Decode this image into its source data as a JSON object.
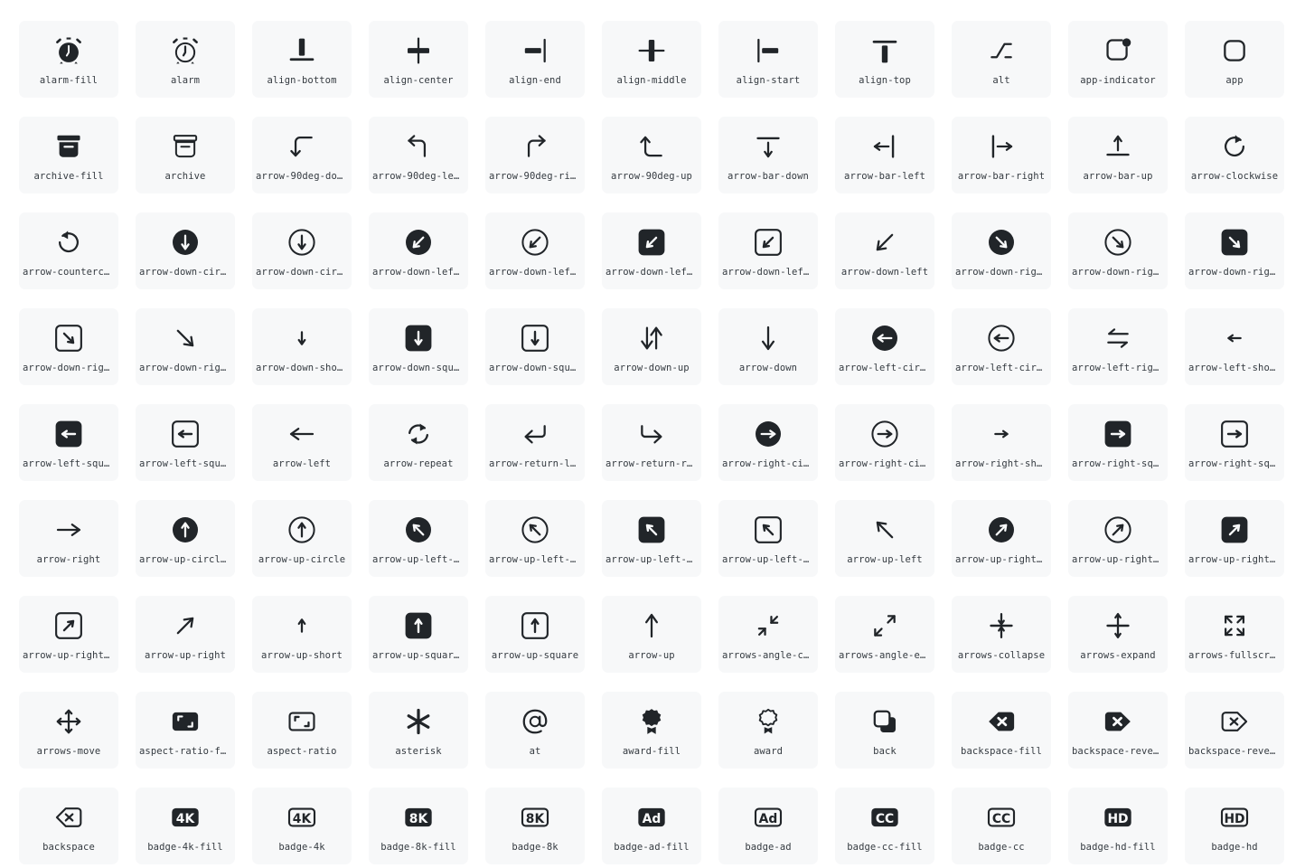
{
  "page": {
    "title": "Bootstrap Icons Gallery",
    "background_color": "#ffffff",
    "tile_color": "#f7f8f9",
    "icon_color": "#212529",
    "label_color": "#343a40",
    "columns": 11,
    "rows": 9,
    "total_visible_icons": 99
  },
  "icons": [
    {
      "name": "alarm-fill",
      "label": "alarm-fill",
      "glyph": "alarm-fill"
    },
    {
      "name": "alarm",
      "label": "alarm",
      "glyph": "alarm"
    },
    {
      "name": "align-bottom",
      "label": "align-bottom",
      "glyph": "align-bottom"
    },
    {
      "name": "align-center",
      "label": "align-center",
      "glyph": "align-center"
    },
    {
      "name": "align-end",
      "label": "align-end",
      "glyph": "align-end"
    },
    {
      "name": "align-middle",
      "label": "align-middle",
      "glyph": "align-middle"
    },
    {
      "name": "align-start",
      "label": "align-start",
      "glyph": "align-start"
    },
    {
      "name": "align-top",
      "label": "align-top",
      "glyph": "align-top"
    },
    {
      "name": "alt",
      "label": "alt",
      "glyph": "alt"
    },
    {
      "name": "app-indicator",
      "label": "app-indicator",
      "glyph": "app-indicator"
    },
    {
      "name": "app",
      "label": "app",
      "glyph": "app"
    },
    {
      "name": "archive-fill",
      "label": "archive-fill",
      "glyph": "archive-fill"
    },
    {
      "name": "archive",
      "label": "archive",
      "glyph": "archive"
    },
    {
      "name": "arrow-90deg-down",
      "label": "arrow-90deg-down",
      "glyph": "arrow-90deg-down"
    },
    {
      "name": "arrow-90deg-left",
      "label": "arrow-90deg-left",
      "glyph": "arrow-90deg-left"
    },
    {
      "name": "arrow-90deg-right",
      "label": "arrow-90deg-rig…",
      "glyph": "arrow-90deg-right"
    },
    {
      "name": "arrow-90deg-up",
      "label": "arrow-90deg-up",
      "glyph": "arrow-90deg-up"
    },
    {
      "name": "arrow-bar-down",
      "label": "arrow-bar-down",
      "glyph": "arrow-bar-down"
    },
    {
      "name": "arrow-bar-left",
      "label": "arrow-bar-left",
      "glyph": "arrow-bar-left"
    },
    {
      "name": "arrow-bar-right",
      "label": "arrow-bar-right",
      "glyph": "arrow-bar-right"
    },
    {
      "name": "arrow-bar-up",
      "label": "arrow-bar-up",
      "glyph": "arrow-bar-up"
    },
    {
      "name": "arrow-clockwise",
      "label": "arrow-clockwise",
      "glyph": "arrow-clockwise"
    },
    {
      "name": "arrow-counterclockwise",
      "label": "arrow-countercl…",
      "glyph": "arrow-counterclockwise"
    },
    {
      "name": "arrow-down-circle-fill",
      "label": "arrow-down-circ…",
      "glyph": "arrow-down-circle-fill"
    },
    {
      "name": "arrow-down-circle",
      "label": "arrow-down-circ…",
      "glyph": "arrow-down-circle"
    },
    {
      "name": "arrow-down-left-circle-fill",
      "label": "arrow-down-left…",
      "glyph": "arrow-down-left-circle-fill"
    },
    {
      "name": "arrow-down-left-circle",
      "label": "arrow-down-left…",
      "glyph": "arrow-down-left-circle"
    },
    {
      "name": "arrow-down-left-square-fill",
      "label": "arrow-down-left…",
      "glyph": "arrow-down-left-square-fill"
    },
    {
      "name": "arrow-down-left-square",
      "label": "arrow-down-left…",
      "glyph": "arrow-down-left-square"
    },
    {
      "name": "arrow-down-left",
      "label": "arrow-down-left",
      "glyph": "arrow-down-left"
    },
    {
      "name": "arrow-down-right-circle-fill",
      "label": "arrow-down-righ…",
      "glyph": "arrow-down-right-circle-fill"
    },
    {
      "name": "arrow-down-right-circle",
      "label": "arrow-down-righ…",
      "glyph": "arrow-down-right-circle"
    },
    {
      "name": "arrow-down-right-square-fill",
      "label": "arrow-down-righ…",
      "glyph": "arrow-down-right-square-fill"
    },
    {
      "name": "arrow-down-right-square",
      "label": "arrow-down-righ…",
      "glyph": "arrow-down-right-square"
    },
    {
      "name": "arrow-down-right",
      "label": "arrow-down-right",
      "glyph": "arrow-down-right"
    },
    {
      "name": "arrow-down-short",
      "label": "arrow-down-short",
      "glyph": "arrow-down-short"
    },
    {
      "name": "arrow-down-square-fill",
      "label": "arrow-down-squa…",
      "glyph": "arrow-down-square-fill"
    },
    {
      "name": "arrow-down-square",
      "label": "arrow-down-squa…",
      "glyph": "arrow-down-square"
    },
    {
      "name": "arrow-down-up",
      "label": "arrow-down-up",
      "glyph": "arrow-down-up"
    },
    {
      "name": "arrow-down",
      "label": "arrow-down",
      "glyph": "arrow-down"
    },
    {
      "name": "arrow-left-circle-fill",
      "label": "arrow-left-circ…",
      "glyph": "arrow-left-circle-fill"
    },
    {
      "name": "arrow-left-circle",
      "label": "arrow-left-circ…",
      "glyph": "arrow-left-circle"
    },
    {
      "name": "arrow-left-right",
      "label": "arrow-left-right",
      "glyph": "arrow-left-right"
    },
    {
      "name": "arrow-left-short",
      "label": "arrow-left-short",
      "glyph": "arrow-left-short"
    },
    {
      "name": "arrow-left-square-fill",
      "label": "arrow-left-squa…",
      "glyph": "arrow-left-square-fill"
    },
    {
      "name": "arrow-left-square",
      "label": "arrow-left-squa…",
      "glyph": "arrow-left-square"
    },
    {
      "name": "arrow-left",
      "label": "arrow-left",
      "glyph": "arrow-left"
    },
    {
      "name": "arrow-repeat",
      "label": "arrow-repeat",
      "glyph": "arrow-repeat"
    },
    {
      "name": "arrow-return-left",
      "label": "arrow-return-le…",
      "glyph": "arrow-return-left"
    },
    {
      "name": "arrow-return-right",
      "label": "arrow-return-ri…",
      "glyph": "arrow-return-right"
    },
    {
      "name": "arrow-right-circle-fill",
      "label": "arrow-right-cir…",
      "glyph": "arrow-right-circle-fill"
    },
    {
      "name": "arrow-right-circle",
      "label": "arrow-right-cir…",
      "glyph": "arrow-right-circle"
    },
    {
      "name": "arrow-right-short",
      "label": "arrow-right-sho…",
      "glyph": "arrow-right-short"
    },
    {
      "name": "arrow-right-square-fill",
      "label": "arrow-right-squ…",
      "glyph": "arrow-right-square-fill"
    },
    {
      "name": "arrow-right-square",
      "label": "arrow-right-squ…",
      "glyph": "arrow-right-square"
    },
    {
      "name": "arrow-right",
      "label": "arrow-right",
      "glyph": "arrow-right"
    },
    {
      "name": "arrow-up-circle-fill",
      "label": "arrow-up-circle…",
      "glyph": "arrow-up-circle-fill"
    },
    {
      "name": "arrow-up-circle",
      "label": "arrow-up-circle",
      "glyph": "arrow-up-circle"
    },
    {
      "name": "arrow-up-left-circle-fill",
      "label": "arrow-up-left-c…",
      "glyph": "arrow-up-left-circle-fill"
    },
    {
      "name": "arrow-up-left-circle",
      "label": "arrow-up-left-c…",
      "glyph": "arrow-up-left-circle"
    },
    {
      "name": "arrow-up-left-square-fill",
      "label": "arrow-up-left-s…",
      "glyph": "arrow-up-left-square-fill"
    },
    {
      "name": "arrow-up-left-square",
      "label": "arrow-up-left-s…",
      "glyph": "arrow-up-left-square"
    },
    {
      "name": "arrow-up-left",
      "label": "arrow-up-left",
      "glyph": "arrow-up-left"
    },
    {
      "name": "arrow-up-right-circle-fill",
      "label": "arrow-up-right-…",
      "glyph": "arrow-up-right-circle-fill"
    },
    {
      "name": "arrow-up-right-circle",
      "label": "arrow-up-right-…",
      "glyph": "arrow-up-right-circle"
    },
    {
      "name": "arrow-up-right-square-fill",
      "label": "arrow-up-right-…",
      "glyph": "arrow-up-right-square-fill"
    },
    {
      "name": "arrow-up-right-square",
      "label": "arrow-up-right-…",
      "glyph": "arrow-up-right-square"
    },
    {
      "name": "arrow-up-right",
      "label": "arrow-up-right",
      "glyph": "arrow-up-right"
    },
    {
      "name": "arrow-up-short",
      "label": "arrow-up-short",
      "glyph": "arrow-up-short"
    },
    {
      "name": "arrow-up-square-fill",
      "label": "arrow-up-square…",
      "glyph": "arrow-up-square-fill"
    },
    {
      "name": "arrow-up-square",
      "label": "arrow-up-square",
      "glyph": "arrow-up-square"
    },
    {
      "name": "arrow-up",
      "label": "arrow-up",
      "glyph": "arrow-up"
    },
    {
      "name": "arrows-angle-contract",
      "label": "arrows-angle-co…",
      "glyph": "arrows-angle-contract"
    },
    {
      "name": "arrows-angle-expand",
      "label": "arrows-angle-ex…",
      "glyph": "arrows-angle-expand"
    },
    {
      "name": "arrows-collapse",
      "label": "arrows-collapse",
      "glyph": "arrows-collapse"
    },
    {
      "name": "arrows-expand",
      "label": "arrows-expand",
      "glyph": "arrows-expand"
    },
    {
      "name": "arrows-fullscreen",
      "label": "arrows-fullscre…",
      "glyph": "arrows-fullscreen"
    },
    {
      "name": "arrows-move",
      "label": "arrows-move",
      "glyph": "arrows-move"
    },
    {
      "name": "aspect-ratio-fill",
      "label": "aspect-ratio-fi…",
      "glyph": "aspect-ratio-fill"
    },
    {
      "name": "aspect-ratio",
      "label": "aspect-ratio",
      "glyph": "aspect-ratio"
    },
    {
      "name": "asterisk",
      "label": "asterisk",
      "glyph": "asterisk"
    },
    {
      "name": "at",
      "label": "at",
      "glyph": "at"
    },
    {
      "name": "award-fill",
      "label": "award-fill",
      "glyph": "award-fill"
    },
    {
      "name": "award",
      "label": "award",
      "glyph": "award"
    },
    {
      "name": "back",
      "label": "back",
      "glyph": "back"
    },
    {
      "name": "backspace-fill",
      "label": "backspace-fill",
      "glyph": "backspace-fill"
    },
    {
      "name": "backspace-reverse-fill",
      "label": "backspace-rever…",
      "glyph": "backspace-reverse-fill"
    },
    {
      "name": "backspace-reverse",
      "label": "backspace-rever…",
      "glyph": "backspace-reverse"
    },
    {
      "name": "backspace",
      "label": "backspace",
      "glyph": "backspace"
    },
    {
      "name": "badge-4k-fill",
      "label": "badge-4k-fill",
      "glyph": "badge-4k-fill",
      "text": "4K"
    },
    {
      "name": "badge-4k",
      "label": "badge-4k",
      "glyph": "badge-4k",
      "text": "4K"
    },
    {
      "name": "badge-8k-fill",
      "label": "badge-8k-fill",
      "glyph": "badge-8k-fill",
      "text": "8K"
    },
    {
      "name": "badge-8k",
      "label": "badge-8k",
      "glyph": "badge-8k",
      "text": "8K"
    },
    {
      "name": "badge-ad-fill",
      "label": "badge-ad-fill",
      "glyph": "badge-ad-fill",
      "text": "Ad"
    },
    {
      "name": "badge-ad",
      "label": "badge-ad",
      "glyph": "badge-ad",
      "text": "Ad"
    },
    {
      "name": "badge-cc-fill",
      "label": "badge-cc-fill",
      "glyph": "badge-cc-fill",
      "text": "CC"
    },
    {
      "name": "badge-cc",
      "label": "badge-cc",
      "glyph": "badge-cc",
      "text": "CC"
    },
    {
      "name": "badge-hd-fill",
      "label": "badge-hd-fill",
      "glyph": "badge-hd-fill",
      "text": "HD"
    },
    {
      "name": "badge-hd",
      "label": "badge-hd",
      "glyph": "badge-hd",
      "text": "HD"
    }
  ]
}
